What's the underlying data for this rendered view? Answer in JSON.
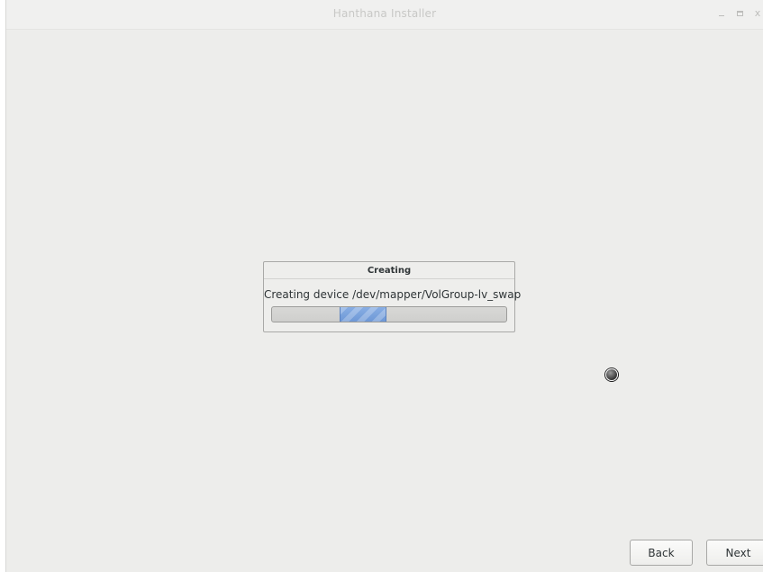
{
  "window": {
    "title": "Hanthana Installer",
    "controls": {
      "minimize": "_",
      "maximize": "□",
      "close": "x"
    }
  },
  "progress_dialog": {
    "title": "Creating",
    "message": "Creating device /dev/mapper/VolGroup-lv_swap",
    "progress_mode": "indeterminate"
  },
  "footer": {
    "back_label": "Back",
    "next_label": "Next"
  },
  "cursor": {
    "icon": "busy-cursor-icon"
  },
  "colors": {
    "background": "#ededeb",
    "progress_fill": "#7aa3de",
    "text": "#2e3436"
  }
}
